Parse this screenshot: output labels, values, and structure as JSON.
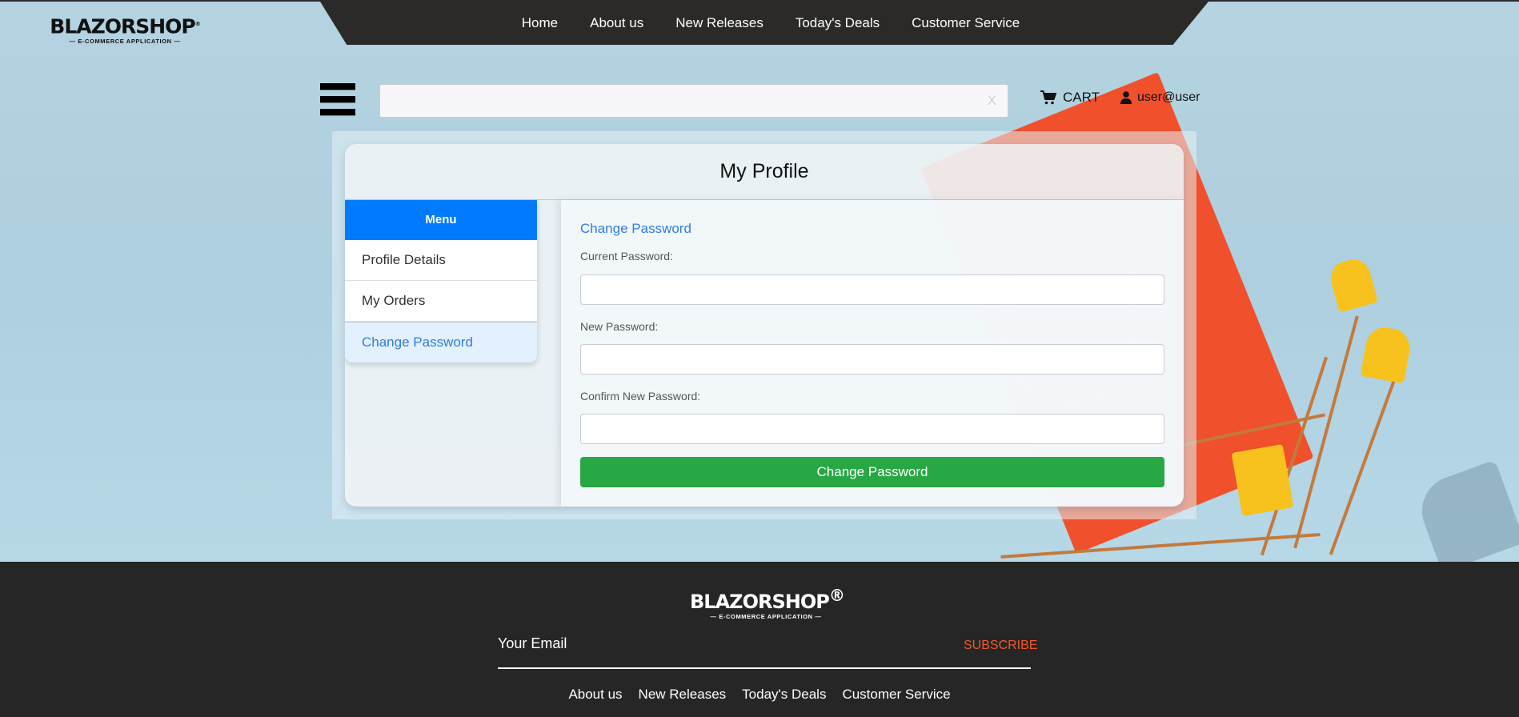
{
  "brand": {
    "name": "BLAZORSHOP",
    "trademark": "®",
    "tagline": "— E-COMMERCE APPLICATION —"
  },
  "nav": {
    "links": [
      "Home",
      "About us",
      "New Releases",
      "Today's Deals",
      "Customer Service"
    ]
  },
  "toolbar": {
    "menu_icon": "hamburger-icon",
    "search": {
      "value": "",
      "placeholder": "",
      "clear_label": "X"
    },
    "cart_label": "CART",
    "cart_icon": "shopping-cart-icon",
    "user_label": "user@user",
    "user_icon": "user-icon"
  },
  "profile": {
    "title": "My Profile",
    "menu": {
      "header": "Menu",
      "items": [
        {
          "label": "Profile Details",
          "active": false
        },
        {
          "label": "My Orders",
          "active": false
        },
        {
          "label": "Change Password",
          "active": true
        }
      ]
    },
    "form": {
      "title": "Change Password",
      "fields": [
        {
          "label": "Current Password:",
          "value": ""
        },
        {
          "label": "New Password:",
          "value": ""
        },
        {
          "label": "Confirm New Password:",
          "value": ""
        }
      ],
      "submit_label": "Change Password"
    }
  },
  "footer": {
    "email_label": "Your Email",
    "subscribe_label": "SUBSCRIBE",
    "links": [
      "About us",
      "New Releases",
      "Today's Deals",
      "Customer Service"
    ]
  },
  "colors": {
    "primary": "#007bff",
    "active_link": "#2f7de1",
    "success": "#28a745",
    "subscribe": "#f0582b",
    "dark": "#2b2a29"
  }
}
